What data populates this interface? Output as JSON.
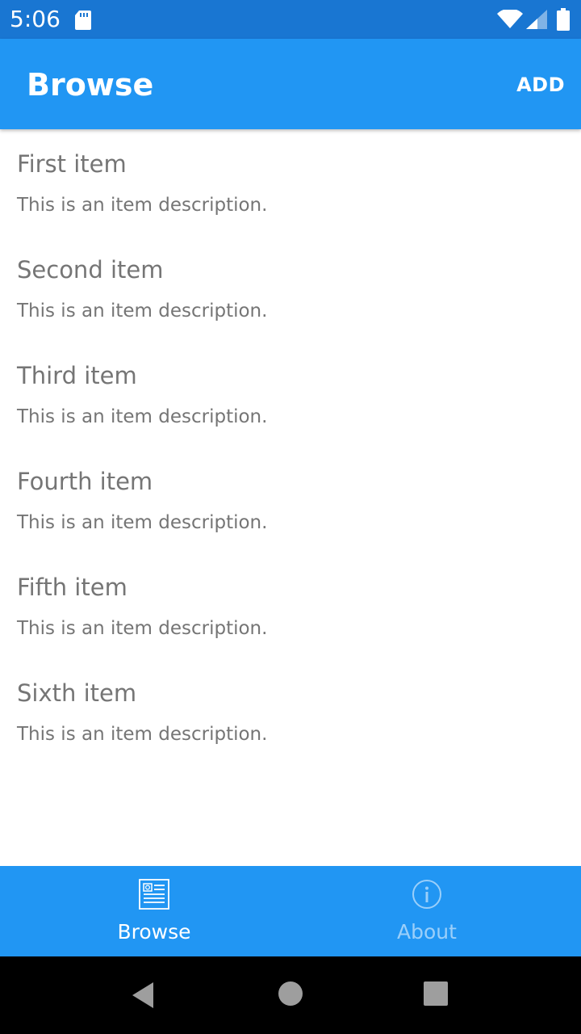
{
  "status_bar": {
    "time": "5:06",
    "icons": [
      "sd-card-icon",
      "wifi-icon",
      "signal-icon",
      "battery-icon"
    ]
  },
  "app_bar": {
    "title": "Browse",
    "add_label": "ADD",
    "background": "#2196F3"
  },
  "items": [
    {
      "title": "First item",
      "description": "This is an item description."
    },
    {
      "title": "Second item",
      "description": "This is an item description."
    },
    {
      "title": "Third item",
      "description": "This is an item description."
    },
    {
      "title": "Fourth item",
      "description": "This is an item description."
    },
    {
      "title": "Fifth item",
      "description": "This is an item description."
    },
    {
      "title": "Sixth item",
      "description": "This is an item description."
    }
  ],
  "tabs": [
    {
      "label": "Browse",
      "icon": "browse-list-icon",
      "selected": true
    },
    {
      "label": "About",
      "icon": "info-icon",
      "selected": false
    }
  ],
  "nav_bar": {
    "icons": [
      "back-icon",
      "home-icon",
      "recents-icon"
    ]
  },
  "colors": {
    "status_bar": "#1976D2",
    "primary": "#2196F3",
    "item_text": "#757575"
  }
}
